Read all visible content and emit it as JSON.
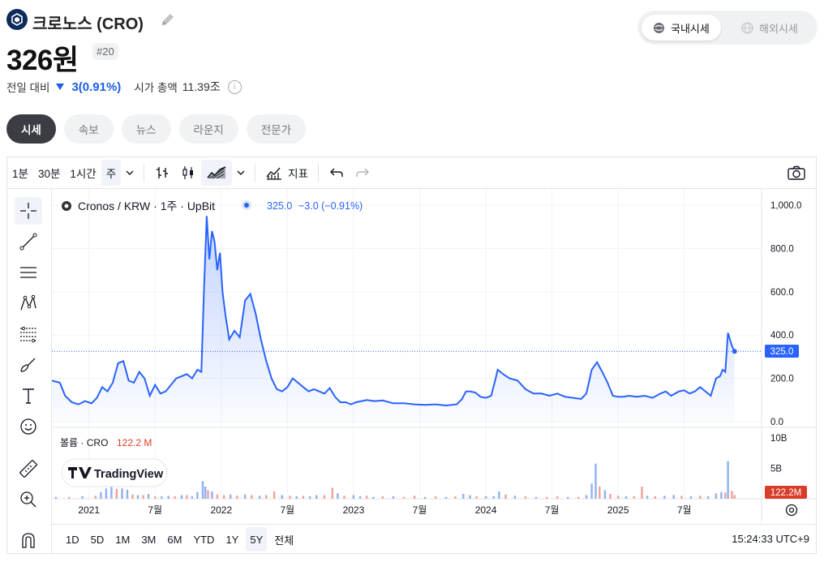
{
  "header": {
    "coin_name": "크로노스 (CRO)",
    "price": "326원",
    "rank": "#20",
    "change_label": "전일 대비",
    "change_value": "3(0.91%)",
    "market_cap_label": "시가 총액",
    "market_cap_value": "11.39조",
    "info_icon": "ⓘ"
  },
  "market_toggle": {
    "domestic": "국내시세",
    "overseas": "해외시세"
  },
  "tabs": [
    "시세",
    "속보",
    "뉴스",
    "라운지",
    "전문가"
  ],
  "toolbar": {
    "intervals": [
      "1분",
      "30분",
      "1시간",
      "주"
    ],
    "selected_interval": "주",
    "indicators_label": "지표"
  },
  "legend": {
    "symbol": "Cronos",
    "pair": "KRW",
    "interval": "1주",
    "exchange": "UpBit",
    "sep": "/",
    "dot": "·",
    "last_value": "325.0",
    "change": "−3.0 (−0.91%)"
  },
  "volume_legend": {
    "label": "볼륨 · CRO",
    "value": "122.2 M"
  },
  "watermark": "TradingView",
  "ranges": [
    "1D",
    "5D",
    "1M",
    "3M",
    "6M",
    "YTD",
    "1Y",
    "5Y",
    "전체"
  ],
  "selected_range": "5Y",
  "clock": "15:24:33 UTC+9",
  "colors": {
    "line": "#2962ff",
    "accent_blue": "#1a5ee8",
    "vol_up": "#8fb0f5",
    "vol_down": "#f2a19a",
    "price_tag": "#2962ff",
    "vol_tag": "#d93d2a"
  },
  "chart_data": {
    "type": "area",
    "title": "Cronos / KRW · 1주 · UpBit",
    "y_axis": {
      "min": 0,
      "max": 1000,
      "ticks": [
        "1,000.0",
        "800.0",
        "600.0",
        "400.0",
        "200.0",
        "0.0"
      ],
      "tick_values": [
        1000,
        800,
        600,
        400,
        200,
        0
      ]
    },
    "x_axis": {
      "ticks": [
        "2021",
        "7월",
        "2022",
        "7월",
        "2023",
        "7월",
        "2024",
        "7월",
        "2025",
        "7월"
      ],
      "tick_dates": [
        2021.0,
        2021.5,
        2022.0,
        2022.5,
        2023.0,
        2023.5,
        2024.0,
        2024.5,
        2025.0,
        2025.5
      ],
      "range": [
        2020.72,
        2025.9
      ]
    },
    "last_price_label": "325.0",
    "volume_axis": {
      "ticks": [
        "10B",
        "5B"
      ],
      "tick_values": [
        10,
        5
      ],
      "max": 11.5,
      "unit": "B"
    },
    "volume_last_label": "122.2M",
    "series": [
      {
        "name": "Cronos / KRW",
        "points": [
          [
            2020.72,
            190
          ],
          [
            2020.78,
            180
          ],
          [
            2020.82,
            120
          ],
          [
            2020.87,
            90
          ],
          [
            2020.92,
            80
          ],
          [
            2020.97,
            95
          ],
          [
            2021.02,
            85
          ],
          [
            2021.06,
            110
          ],
          [
            2021.1,
            160
          ],
          [
            2021.14,
            140
          ],
          [
            2021.18,
            180
          ],
          [
            2021.22,
            270
          ],
          [
            2021.26,
            280
          ],
          [
            2021.3,
            190
          ],
          [
            2021.34,
            180
          ],
          [
            2021.38,
            230
          ],
          [
            2021.42,
            200
          ],
          [
            2021.46,
            120
          ],
          [
            2021.5,
            170
          ],
          [
            2021.54,
            130
          ],
          [
            2021.58,
            140
          ],
          [
            2021.62,
            170
          ],
          [
            2021.66,
            200
          ],
          [
            2021.7,
            210
          ],
          [
            2021.74,
            220
          ],
          [
            2021.78,
            200
          ],
          [
            2021.82,
            240
          ],
          [
            2021.85,
            230
          ],
          [
            2021.87,
            620
          ],
          [
            2021.89,
            950
          ],
          [
            2021.91,
            750
          ],
          [
            2021.93,
            880
          ],
          [
            2021.95,
            830
          ],
          [
            2021.97,
            700
          ],
          [
            2021.99,
            780
          ],
          [
            2022.01,
            600
          ],
          [
            2022.03,
            500
          ],
          [
            2022.06,
            380
          ],
          [
            2022.1,
            420
          ],
          [
            2022.14,
            390
          ],
          [
            2022.18,
            560
          ],
          [
            2022.22,
            590
          ],
          [
            2022.26,
            500
          ],
          [
            2022.3,
            380
          ],
          [
            2022.34,
            280
          ],
          [
            2022.38,
            200
          ],
          [
            2022.42,
            150
          ],
          [
            2022.46,
            140
          ],
          [
            2022.5,
            160
          ],
          [
            2022.54,
            200
          ],
          [
            2022.58,
            180
          ],
          [
            2022.62,
            160
          ],
          [
            2022.66,
            140
          ],
          [
            2022.7,
            150
          ],
          [
            2022.74,
            140
          ],
          [
            2022.78,
            130
          ],
          [
            2022.82,
            155
          ],
          [
            2022.86,
            115
          ],
          [
            2022.9,
            90
          ],
          [
            2022.94,
            90
          ],
          [
            2022.98,
            80
          ],
          [
            2023.02,
            90
          ],
          [
            2023.06,
            95
          ],
          [
            2023.1,
            100
          ],
          [
            2023.16,
            95
          ],
          [
            2023.22,
            98
          ],
          [
            2023.3,
            85
          ],
          [
            2023.38,
            85
          ],
          [
            2023.46,
            80
          ],
          [
            2023.54,
            78
          ],
          [
            2023.62,
            80
          ],
          [
            2023.7,
            75
          ],
          [
            2023.78,
            80
          ],
          [
            2023.82,
            105
          ],
          [
            2023.85,
            140
          ],
          [
            2023.88,
            140
          ],
          [
            2023.92,
            135
          ],
          [
            2023.96,
            115
          ],
          [
            2024.0,
            110
          ],
          [
            2024.04,
            120
          ],
          [
            2024.07,
            190
          ],
          [
            2024.09,
            240
          ],
          [
            2024.13,
            220
          ],
          [
            2024.18,
            200
          ],
          [
            2024.24,
            190
          ],
          [
            2024.3,
            150
          ],
          [
            2024.36,
            130
          ],
          [
            2024.42,
            130
          ],
          [
            2024.48,
            120
          ],
          [
            2024.54,
            130
          ],
          [
            2024.6,
            115
          ],
          [
            2024.66,
            110
          ],
          [
            2024.72,
            105
          ],
          [
            2024.76,
            130
          ],
          [
            2024.8,
            240
          ],
          [
            2024.84,
            275
          ],
          [
            2024.88,
            230
          ],
          [
            2024.92,
            180
          ],
          [
            2024.96,
            120
          ],
          [
            2025.0,
            115
          ],
          [
            2025.04,
            115
          ],
          [
            2025.08,
            120
          ],
          [
            2025.14,
            115
          ],
          [
            2025.2,
            120
          ],
          [
            2025.26,
            110
          ],
          [
            2025.32,
            130
          ],
          [
            2025.36,
            140
          ],
          [
            2025.4,
            120
          ],
          [
            2025.46,
            140
          ],
          [
            2025.5,
            145
          ],
          [
            2025.54,
            130
          ],
          [
            2025.58,
            140
          ],
          [
            2025.62,
            160
          ],
          [
            2025.66,
            140
          ],
          [
            2025.7,
            120
          ],
          [
            2025.74,
            200
          ],
          [
            2025.77,
            210
          ],
          [
            2025.79,
            240
          ],
          [
            2025.81,
            230
          ],
          [
            2025.83,
            410
          ],
          [
            2025.86,
            350
          ],
          [
            2025.88,
            325
          ]
        ]
      }
    ],
    "volume_series": {
      "name": "볼륨 · CRO",
      "values_B": [
        [
          2020.75,
          0.3,
          "up"
        ],
        [
          2020.85,
          0.3,
          "down"
        ],
        [
          2020.95,
          0.4,
          "up"
        ],
        [
          2021.05,
          0.5,
          "down"
        ],
        [
          2021.09,
          1.1,
          "up"
        ],
        [
          2021.13,
          1.7,
          "up"
        ],
        [
          2021.17,
          2.0,
          "up"
        ],
        [
          2021.21,
          1.6,
          "down"
        ],
        [
          2021.25,
          1.7,
          "up"
        ],
        [
          2021.29,
          1.5,
          "up"
        ],
        [
          2021.33,
          0.7,
          "down"
        ],
        [
          2021.37,
          0.6,
          "up"
        ],
        [
          2021.41,
          0.6,
          "down"
        ],
        [
          2021.45,
          0.8,
          "up"
        ],
        [
          2021.5,
          0.4,
          "down"
        ],
        [
          2021.55,
          0.4,
          "up"
        ],
        [
          2021.6,
          0.5,
          "up"
        ],
        [
          2021.65,
          0.4,
          "down"
        ],
        [
          2021.7,
          0.6,
          "up"
        ],
        [
          2021.74,
          0.6,
          "down"
        ],
        [
          2021.78,
          0.4,
          "up"
        ],
        [
          2021.82,
          1.1,
          "up"
        ],
        [
          2021.86,
          2.9,
          "up"
        ],
        [
          2021.88,
          2.0,
          "up"
        ],
        [
          2021.9,
          1.4,
          "down"
        ],
        [
          2021.93,
          1.2,
          "up"
        ],
        [
          2021.97,
          0.7,
          "down"
        ],
        [
          2022.02,
          0.6,
          "down"
        ],
        [
          2022.07,
          0.7,
          "up"
        ],
        [
          2022.12,
          0.5,
          "down"
        ],
        [
          2022.18,
          0.7,
          "up"
        ],
        [
          2022.23,
          0.6,
          "down"
        ],
        [
          2022.29,
          0.5,
          "up"
        ],
        [
          2022.34,
          0.6,
          "down"
        ],
        [
          2022.4,
          1.2,
          "down"
        ],
        [
          2022.46,
          0.6,
          "up"
        ],
        [
          2022.52,
          0.5,
          "down"
        ],
        [
          2022.57,
          0.4,
          "up"
        ],
        [
          2022.62,
          0.5,
          "down"
        ],
        [
          2022.67,
          0.4,
          "up"
        ],
        [
          2022.72,
          0.6,
          "up"
        ],
        [
          2022.78,
          0.6,
          "down"
        ],
        [
          2022.84,
          1.8,
          "down"
        ],
        [
          2022.88,
          0.9,
          "up"
        ],
        [
          2022.93,
          0.5,
          "down"
        ],
        [
          2023.0,
          0.6,
          "up"
        ],
        [
          2023.05,
          0.4,
          "up"
        ],
        [
          2023.1,
          0.5,
          "down"
        ],
        [
          2023.15,
          0.3,
          "up"
        ],
        [
          2023.22,
          0.4,
          "down"
        ],
        [
          2023.3,
          0.4,
          "up"
        ],
        [
          2023.38,
          0.3,
          "down"
        ],
        [
          2023.46,
          0.5,
          "down"
        ],
        [
          2023.54,
          0.3,
          "up"
        ],
        [
          2023.62,
          0.4,
          "down"
        ],
        [
          2023.7,
          0.3,
          "up"
        ],
        [
          2023.77,
          0.4,
          "down"
        ],
        [
          2023.83,
          0.8,
          "up"
        ],
        [
          2023.88,
          0.6,
          "up"
        ],
        [
          2023.93,
          0.4,
          "down"
        ],
        [
          2024.0,
          0.4,
          "up"
        ],
        [
          2024.06,
          0.4,
          "up"
        ],
        [
          2024.1,
          1.2,
          "up"
        ],
        [
          2024.15,
          0.7,
          "down"
        ],
        [
          2024.22,
          0.5,
          "up"
        ],
        [
          2024.3,
          0.4,
          "down"
        ],
        [
          2024.38,
          0.3,
          "up"
        ],
        [
          2024.46,
          0.3,
          "down"
        ],
        [
          2024.54,
          0.4,
          "down"
        ],
        [
          2024.62,
          0.3,
          "up"
        ],
        [
          2024.7,
          0.3,
          "down"
        ],
        [
          2024.76,
          0.6,
          "up"
        ],
        [
          2024.8,
          2.5,
          "up"
        ],
        [
          2024.83,
          5.8,
          "up"
        ],
        [
          2024.86,
          2.0,
          "down"
        ],
        [
          2024.9,
          1.4,
          "up"
        ],
        [
          2024.94,
          0.8,
          "down"
        ],
        [
          2025.0,
          0.5,
          "down"
        ],
        [
          2025.06,
          0.4,
          "up"
        ],
        [
          2025.12,
          0.4,
          "down"
        ],
        [
          2025.18,
          2.0,
          "down"
        ],
        [
          2025.22,
          0.5,
          "up"
        ],
        [
          2025.28,
          0.4,
          "down"
        ],
        [
          2025.35,
          0.5,
          "up"
        ],
        [
          2025.42,
          0.6,
          "up"
        ],
        [
          2025.48,
          0.5,
          "down"
        ],
        [
          2025.55,
          0.4,
          "up"
        ],
        [
          2025.62,
          0.5,
          "down"
        ],
        [
          2025.68,
          0.4,
          "up"
        ],
        [
          2025.74,
          0.9,
          "up"
        ],
        [
          2025.78,
          1.1,
          "up"
        ],
        [
          2025.81,
          1.0,
          "down"
        ],
        [
          2025.83,
          6.2,
          "up"
        ],
        [
          2025.86,
          1.3,
          "down"
        ],
        [
          2025.88,
          0.6,
          "down"
        ]
      ]
    }
  }
}
